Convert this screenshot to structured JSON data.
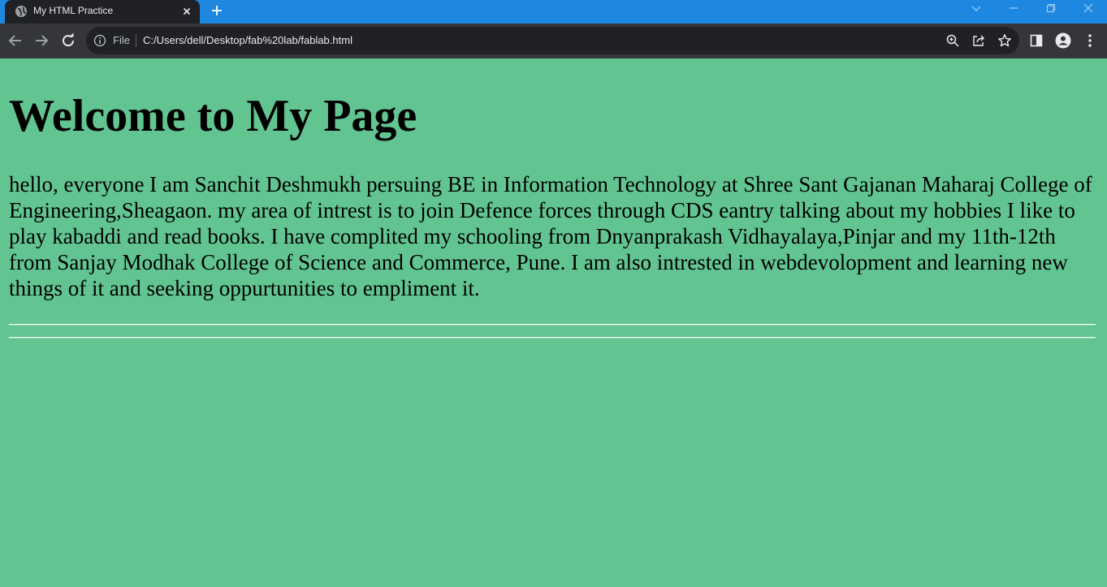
{
  "browser": {
    "tab": {
      "title": "My HTML Practice"
    },
    "omnibox": {
      "file_chip": "File",
      "url": "C:/Users/dell/Desktop/fab%20lab/fablab.html"
    }
  },
  "page": {
    "heading": "Welcome to My Page",
    "paragraph": "hello, everyone I am Sanchit Deshmukh persuing BE in Information Technology at Shree Sant Gajanan Maharaj College of Engineering,Sheagaon. my area of intrest is to join Defence forces through CDS eantry talking about my hobbies I like to play kabaddi and read books. I have complited my schooling from Dnyanprakash Vidhayalaya,Pinjar and my 11th-12th from Sanjay Modhak College of Science and Commerce, Pune. I am also intrested in webdevolopment and learning new things of it and seeking oppurtunities to empliment it.",
    "background_color": "#62c591"
  },
  "colors": {
    "tabstrip": "#1e88e0",
    "toolbar": "#35363a",
    "omnibox": "#202124"
  },
  "icons": [
    "globe-icon",
    "close-icon",
    "plus-icon",
    "chevron-down-icon",
    "minimize-icon",
    "restore-icon",
    "window-close-icon",
    "back-arrow-icon",
    "forward-arrow-icon",
    "reload-icon",
    "info-icon",
    "zoom-icon",
    "share-icon",
    "star-icon",
    "side-panel-icon",
    "profile-icon",
    "kebab-menu-icon"
  ]
}
